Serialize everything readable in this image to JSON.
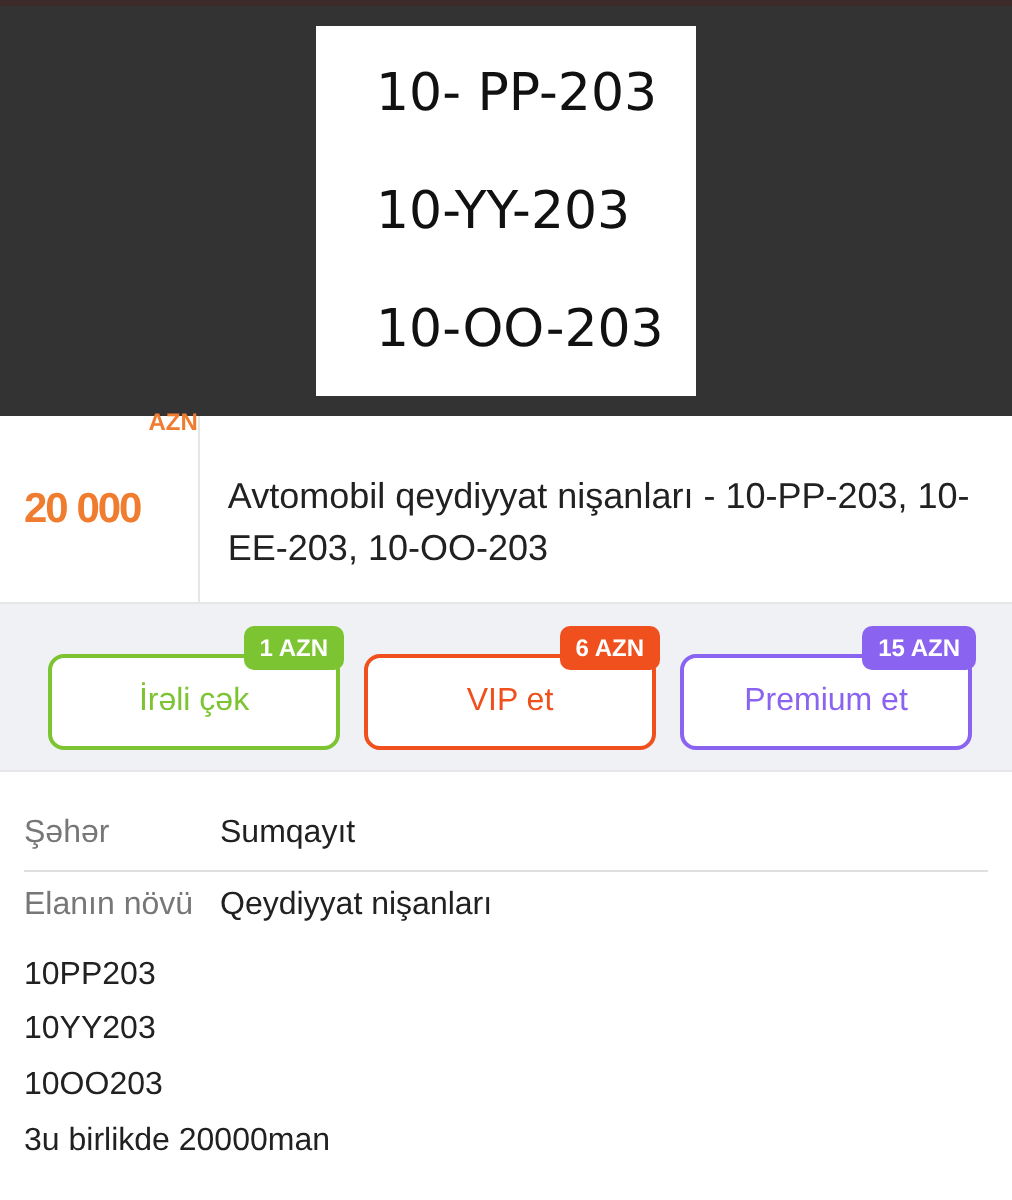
{
  "gallery": {
    "image_lines": [
      "10- PP-203",
      "10-YY-203",
      "10-OO-203"
    ]
  },
  "listing": {
    "price": "20 000",
    "currency": "AZN",
    "title": "Avtomobil qeydiyyat nişanları - 10-PP-203, 10-EE-203, 10-OO-203"
  },
  "promotions": [
    {
      "label": "İrəli çək",
      "price": "1 AZN",
      "color": "#7cc431"
    },
    {
      "label": "VIP et",
      "price": "6 AZN",
      "color": "#f0501e"
    },
    {
      "label": "Premium et",
      "price": "15 AZN",
      "color": "#8a63f0"
    }
  ],
  "properties": [
    {
      "label": "Şəhər",
      "value": "Sumqayıt"
    },
    {
      "label": "Elanın növü",
      "value": "Qeydiyyat nişanları"
    }
  ],
  "description": [
    "10PP203",
    "10YY203",
    "10OO203",
    "3u birlikde 20000man"
  ]
}
